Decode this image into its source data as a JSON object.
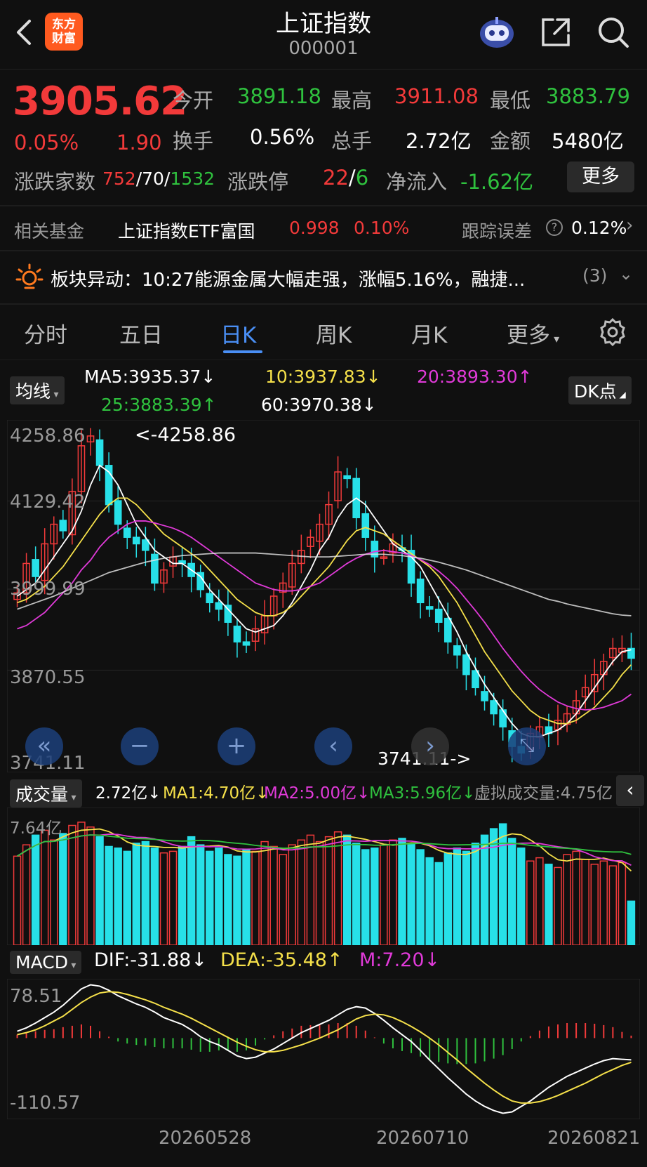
{
  "header": {
    "title": "上证指数",
    "code": "000001",
    "logo_text_1": "东方",
    "logo_text_2": "财富"
  },
  "quote": {
    "price": "3905.62",
    "change_pct": "0.05%",
    "change": "1.90",
    "open_label": "今开",
    "open": "3891.18",
    "high_label": "最高",
    "high": "3911.08",
    "low_label": "最低",
    "low": "3883.79",
    "turnover_label": "换手",
    "turnover": "0.56%",
    "volume_label": "总手",
    "volume": "2.72亿",
    "amount_label": "金额",
    "amount": "5480亿",
    "breadth_label": "涨跌家数",
    "up_count": "752",
    "flat_count": "70",
    "down_count": "1532",
    "sep": "/",
    "limit_label": "涨跌停",
    "limit_up": "22",
    "limit_down": "6",
    "netflow_label": "净流入",
    "netflow": "-1.62亿",
    "more_label": "更多"
  },
  "fund": {
    "label": "相关基金",
    "name": "上证指数ETF富国",
    "price": "0.998",
    "pct": "0.10%",
    "tracking_label": "跟踪误差",
    "tracking_value": "0.12%"
  },
  "alert": {
    "text": "板块异动：10:27能源金属大幅走强，涨幅5.16%，融捷...",
    "count": "(3)"
  },
  "tabs": [
    "分时",
    "五日",
    "日K",
    "周K",
    "月K",
    "更多"
  ],
  "ma": {
    "selector": "均线",
    "ma5": "MA5:3935.37↓",
    "ma10": "10:3937.83↓",
    "ma20": "20:3893.30↑",
    "ma25": "25:3883.39↑",
    "ma60": "60:3970.38↓",
    "dk": "DK点"
  },
  "price_axis": [
    "4258.86",
    "4129.42",
    "3999.99",
    "3870.55",
    "3741.11"
  ],
  "annotations": {
    "high": "<-4258.86",
    "low": "3741.11->"
  },
  "volume": {
    "selector": "成交量",
    "cur": "2.72亿↓",
    "ma1": "MA1:4.70亿↓",
    "ma2": "MA2:5.00亿↓",
    "ma3": "MA3:5.96亿↓",
    "virtual": "虚拟成交量:4.75亿",
    "axis_top": "7.64亿"
  },
  "macd": {
    "selector": "MACD",
    "dif": "DIF:-31.88↓",
    "dea": "DEA:-35.48↑",
    "m": "M:7.20↓",
    "axis_top": "78.51",
    "axis_bottom": "-110.57"
  },
  "dates": [
    "20260528",
    "20260710",
    "20260821"
  ],
  "colors": {
    "up": "#f23a3a",
    "down": "#27e0e8",
    "ma5": "#ffffff",
    "ma10": "#f5e04a",
    "ma20": "#e03ad8",
    "ma25": "#2fc13e",
    "ma60": "#e8e8e8"
  },
  "chart_data": {
    "type": "line",
    "title": "上证指数 日K",
    "ylim": [
      3741.11,
      4258.86
    ],
    "series": [
      {
        "name": "close",
        "values": [
          4005,
          4050,
          4030,
          4080,
          4110,
          4100,
          4160,
          4230,
          4245,
          4200,
          4140,
          4110,
          4090,
          4080,
          4070,
          4020,
          4040,
          4060,
          4050,
          4030,
          4010,
          3990,
          3980,
          3960,
          3930,
          3925,
          3950,
          3970,
          4000,
          4020,
          4050,
          4070,
          4090,
          4110,
          4140,
          4190,
          4180,
          4120,
          4090,
          4060,
          4060,
          4080,
          4070,
          4020,
          3990,
          3980,
          3960,
          3930,
          3910,
          3880,
          3860,
          3840,
          3820,
          3800,
          3770,
          3760,
          3790,
          3800,
          3790,
          3810,
          3820,
          3840,
          3860,
          3880,
          3900,
          3920,
          3920,
          3905
        ]
      },
      {
        "name": "MA5",
        "values": [
          4000,
          4010,
          4020,
          4040,
          4060,
          4080,
          4100,
          4130,
          4170,
          4200,
          4190,
          4170,
          4140,
          4110,
          4090,
          4070,
          4060,
          4050,
          4050,
          4040,
          4030,
          4010,
          3995,
          3980,
          3965,
          3950,
          3945,
          3950,
          3955,
          3970,
          3990,
          4015,
          4040,
          4070,
          4090,
          4120,
          4140,
          4150,
          4140,
          4120,
          4100,
          4080,
          4070,
          4060,
          4045,
          4020,
          3995,
          3970,
          3945,
          3915,
          3890,
          3865,
          3845,
          3825,
          3805,
          3790,
          3785,
          3785,
          3790,
          3795,
          3805,
          3820,
          3840,
          3860,
          3880,
          3900,
          3915,
          3918
        ]
      },
      {
        "name": "MA10",
        "values": [
          3990,
          3995,
          4005,
          4015,
          4030,
          4045,
          4065,
          4085,
          4105,
          4125,
          4140,
          4150,
          4150,
          4140,
          4125,
          4110,
          4095,
          4085,
          4075,
          4065,
          4055,
          4040,
          4025,
          4010,
          3995,
          3985,
          3975,
          3970,
          3970,
          3975,
          3985,
          4000,
          4015,
          4030,
          4045,
          4065,
          4085,
          4100,
          4105,
          4100,
          4095,
          4085,
          4075,
          4065,
          4055,
          4045,
          4030,
          4010,
          3990,
          3965,
          3940,
          3915,
          3895,
          3875,
          3855,
          3840,
          3825,
          3815,
          3810,
          3805,
          3805,
          3810,
          3820,
          3830,
          3845,
          3860,
          3880,
          3895
        ]
      },
      {
        "name": "MA20",
        "values": [
          3950,
          3955,
          3965,
          3975,
          3990,
          4005,
          4020,
          4040,
          4055,
          4075,
          4090,
          4100,
          4110,
          4115,
          4115,
          4112,
          4108,
          4104,
          4098,
          4090,
          4080,
          4070,
          4060,
          4050,
          4040,
          4030,
          4020,
          4015,
          4010,
          4008,
          4008,
          4010,
          4015,
          4020,
          4030,
          4040,
          4050,
          4058,
          4064,
          4068,
          4070,
          4068,
          4066,
          4062,
          4056,
          4048,
          4038,
          4026,
          4012,
          3995,
          3978,
          3960,
          3940,
          3920,
          3902,
          3885,
          3870,
          3857,
          3847,
          3838,
          3832,
          3828,
          3826,
          3827,
          3830,
          3835,
          3840,
          3850
        ]
      },
      {
        "name": "MA60",
        "values": [
          3980,
          3985,
          3990,
          3995,
          4000,
          4006,
          4012,
          4018,
          4024,
          4030,
          4036,
          4040,
          4044,
          4048,
          4052,
          4055,
          4058,
          4060,
          4062,
          4063,
          4064,
          4065,
          4066,
          4066,
          4066,
          4066,
          4066,
          4065,
          4064,
          4063,
          4062,
          4061,
          4060,
          4060,
          4060,
          4061,
          4062,
          4063,
          4064,
          4064,
          4064,
          4063,
          4062,
          4060,
          4058,
          4055,
          4052,
          4048,
          4044,
          4040,
          4035,
          4030,
          4025,
          4020,
          4015,
          4010,
          4005,
          4000,
          3995,
          3992,
          3988,
          3985,
          3982,
          3979,
          3976,
          3973,
          3971,
          3970
        ]
      }
    ],
    "volume": [
      5.5,
      6.2,
      6.8,
      7.1,
      6.5,
      6.9,
      7.4,
      7.6,
      7.3,
      6.7,
      6.1,
      6.0,
      5.8,
      6.3,
      6.4,
      6.0,
      5.7,
      5.8,
      6.1,
      6.7,
      6.2,
      5.8,
      6.0,
      5.6,
      5.5,
      5.9,
      5.8,
      6.4,
      6.1,
      5.6,
      6.2,
      6.5,
      6.8,
      6.4,
      6.7,
      7.0,
      6.8,
      6.3,
      5.9,
      6.0,
      6.2,
      6.5,
      6.6,
      6.3,
      5.9,
      5.4,
      5.1,
      5.7,
      6.0,
      5.8,
      6.3,
      6.8,
      7.2,
      7.5,
      6.6,
      6.0,
      5.2,
      5.4,
      5.0,
      4.8,
      5.6,
      5.8,
      5.3,
      5.0,
      5.2,
      4.9,
      5.1,
      2.72
    ],
    "macd_dif": [
      10,
      15,
      22,
      30,
      38,
      48,
      60,
      72,
      78,
      76,
      70,
      62,
      56,
      50,
      45,
      38,
      30,
      25,
      20,
      12,
      2,
      -5,
      -10,
      -18,
      -26,
      -30,
      -28,
      -22,
      -16,
      -8,
      0,
      8,
      14,
      20,
      26,
      34,
      42,
      46,
      44,
      36,
      26,
      15,
      5,
      -5,
      -18,
      -32,
      -45,
      -58,
      -70,
      -82,
      -92,
      -100,
      -106,
      -110,
      -108,
      -100,
      -92,
      -82,
      -72,
      -64,
      -56,
      -50,
      -44,
      -38,
      -33,
      -30,
      -31,
      -31.88
    ],
    "macd_dea": [
      5,
      8,
      12,
      18,
      25,
      32,
      42,
      52,
      60,
      66,
      68,
      67,
      64,
      60,
      56,
      51,
      45,
      40,
      35,
      29,
      22,
      15,
      8,
      1,
      -6,
      -12,
      -17,
      -20,
      -20,
      -18,
      -14,
      -10,
      -5,
      0,
      6,
      12,
      20,
      28,
      33,
      35,
      34,
      30,
      24,
      17,
      9,
      0,
      -10,
      -21,
      -32,
      -44,
      -55,
      -66,
      -76,
      -85,
      -92,
      -95,
      -95,
      -93,
      -89,
      -84,
      -78,
      -72,
      -66,
      -59,
      -52,
      -46,
      -40,
      -35.48
    ],
    "macd_hist": [
      10,
      14,
      20,
      24,
      26,
      32,
      36,
      40,
      36,
      20,
      4,
      -10,
      -16,
      -20,
      -22,
      -26,
      -30,
      -30,
      -30,
      -34,
      -40,
      -40,
      -36,
      -38,
      -40,
      -36,
      -22,
      -4,
      8,
      20,
      28,
      36,
      38,
      40,
      40,
      44,
      44,
      36,
      22,
      2,
      -16,
      -30,
      -38,
      -44,
      -54,
      -64,
      -70,
      -74,
      -76,
      -76,
      -74,
      -68,
      -60,
      -50,
      -32,
      -10,
      6,
      22,
      34,
      40,
      44,
      44,
      44,
      42,
      38,
      32,
      18,
      7.2
    ]
  }
}
